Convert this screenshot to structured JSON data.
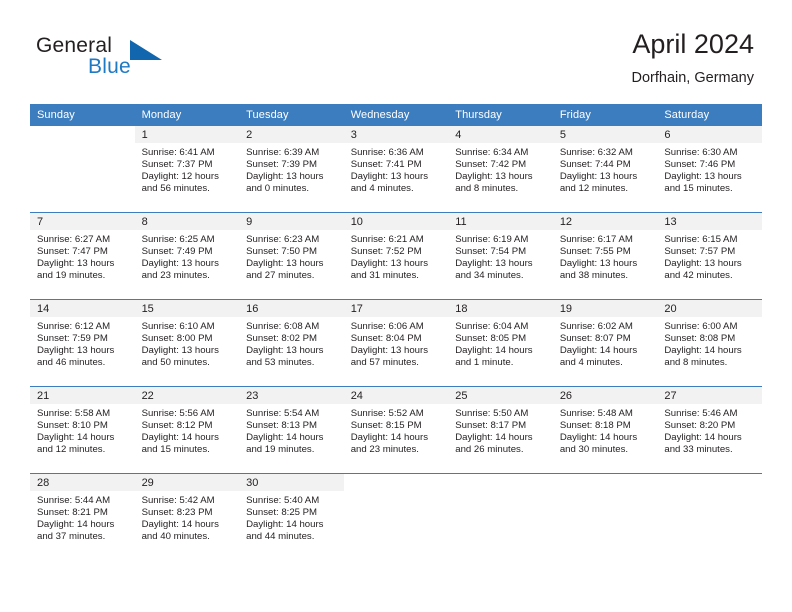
{
  "brand": {
    "word1": "General",
    "word2": "Blue",
    "triangle_color": "#1166ad",
    "blue_text_color": "#1f7ac4"
  },
  "header": {
    "title": "April 2024",
    "subtitle": "Dorfhain, Germany",
    "header_bg": "#3c7dbf",
    "daynum_band_bg": "#f2f2f2"
  },
  "weekdays": [
    "Sunday",
    "Monday",
    "Tuesday",
    "Wednesday",
    "Thursday",
    "Friday",
    "Saturday"
  ],
  "labels": {
    "sunrise_prefix": "Sunrise:",
    "sunset_prefix": "Sunset:",
    "daylight_prefix": "Daylight:"
  },
  "weeks": [
    [
      {
        "day": "",
        "blank": true
      },
      {
        "day": "1",
        "sunrise": "Sunrise: 6:41 AM",
        "sunset": "Sunset: 7:37 PM",
        "daylight1": "Daylight: 12 hours",
        "daylight2": "and 56 minutes."
      },
      {
        "day": "2",
        "sunrise": "Sunrise: 6:39 AM",
        "sunset": "Sunset: 7:39 PM",
        "daylight1": "Daylight: 13 hours",
        "daylight2": "and 0 minutes."
      },
      {
        "day": "3",
        "sunrise": "Sunrise: 6:36 AM",
        "sunset": "Sunset: 7:41 PM",
        "daylight1": "Daylight: 13 hours",
        "daylight2": "and 4 minutes."
      },
      {
        "day": "4",
        "sunrise": "Sunrise: 6:34 AM",
        "sunset": "Sunset: 7:42 PM",
        "daylight1": "Daylight: 13 hours",
        "daylight2": "and 8 minutes."
      },
      {
        "day": "5",
        "sunrise": "Sunrise: 6:32 AM",
        "sunset": "Sunset: 7:44 PM",
        "daylight1": "Daylight: 13 hours",
        "daylight2": "and 12 minutes."
      },
      {
        "day": "6",
        "sunrise": "Sunrise: 6:30 AM",
        "sunset": "Sunset: 7:46 PM",
        "daylight1": "Daylight: 13 hours",
        "daylight2": "and 15 minutes."
      }
    ],
    [
      {
        "day": "7",
        "sunrise": "Sunrise: 6:27 AM",
        "sunset": "Sunset: 7:47 PM",
        "daylight1": "Daylight: 13 hours",
        "daylight2": "and 19 minutes."
      },
      {
        "day": "8",
        "sunrise": "Sunrise: 6:25 AM",
        "sunset": "Sunset: 7:49 PM",
        "daylight1": "Daylight: 13 hours",
        "daylight2": "and 23 minutes."
      },
      {
        "day": "9",
        "sunrise": "Sunrise: 6:23 AM",
        "sunset": "Sunset: 7:50 PM",
        "daylight1": "Daylight: 13 hours",
        "daylight2": "and 27 minutes."
      },
      {
        "day": "10",
        "sunrise": "Sunrise: 6:21 AM",
        "sunset": "Sunset: 7:52 PM",
        "daylight1": "Daylight: 13 hours",
        "daylight2": "and 31 minutes."
      },
      {
        "day": "11",
        "sunrise": "Sunrise: 6:19 AM",
        "sunset": "Sunset: 7:54 PM",
        "daylight1": "Daylight: 13 hours",
        "daylight2": "and 34 minutes."
      },
      {
        "day": "12",
        "sunrise": "Sunrise: 6:17 AM",
        "sunset": "Sunset: 7:55 PM",
        "daylight1": "Daylight: 13 hours",
        "daylight2": "and 38 minutes."
      },
      {
        "day": "13",
        "sunrise": "Sunrise: 6:15 AM",
        "sunset": "Sunset: 7:57 PM",
        "daylight1": "Daylight: 13 hours",
        "daylight2": "and 42 minutes."
      }
    ],
    [
      {
        "day": "14",
        "sunrise": "Sunrise: 6:12 AM",
        "sunset": "Sunset: 7:59 PM",
        "daylight1": "Daylight: 13 hours",
        "daylight2": "and 46 minutes."
      },
      {
        "day": "15",
        "sunrise": "Sunrise: 6:10 AM",
        "sunset": "Sunset: 8:00 PM",
        "daylight1": "Daylight: 13 hours",
        "daylight2": "and 50 minutes."
      },
      {
        "day": "16",
        "sunrise": "Sunrise: 6:08 AM",
        "sunset": "Sunset: 8:02 PM",
        "daylight1": "Daylight: 13 hours",
        "daylight2": "and 53 minutes."
      },
      {
        "day": "17",
        "sunrise": "Sunrise: 6:06 AM",
        "sunset": "Sunset: 8:04 PM",
        "daylight1": "Daylight: 13 hours",
        "daylight2": "and 57 minutes."
      },
      {
        "day": "18",
        "sunrise": "Sunrise: 6:04 AM",
        "sunset": "Sunset: 8:05 PM",
        "daylight1": "Daylight: 14 hours",
        "daylight2": "and 1 minute."
      },
      {
        "day": "19",
        "sunrise": "Sunrise: 6:02 AM",
        "sunset": "Sunset: 8:07 PM",
        "daylight1": "Daylight: 14 hours",
        "daylight2": "and 4 minutes."
      },
      {
        "day": "20",
        "sunrise": "Sunrise: 6:00 AM",
        "sunset": "Sunset: 8:08 PM",
        "daylight1": "Daylight: 14 hours",
        "daylight2": "and 8 minutes."
      }
    ],
    [
      {
        "day": "21",
        "sunrise": "Sunrise: 5:58 AM",
        "sunset": "Sunset: 8:10 PM",
        "daylight1": "Daylight: 14 hours",
        "daylight2": "and 12 minutes."
      },
      {
        "day": "22",
        "sunrise": "Sunrise: 5:56 AM",
        "sunset": "Sunset: 8:12 PM",
        "daylight1": "Daylight: 14 hours",
        "daylight2": "and 15 minutes."
      },
      {
        "day": "23",
        "sunrise": "Sunrise: 5:54 AM",
        "sunset": "Sunset: 8:13 PM",
        "daylight1": "Daylight: 14 hours",
        "daylight2": "and 19 minutes."
      },
      {
        "day": "24",
        "sunrise": "Sunrise: 5:52 AM",
        "sunset": "Sunset: 8:15 PM",
        "daylight1": "Daylight: 14 hours",
        "daylight2": "and 23 minutes."
      },
      {
        "day": "25",
        "sunrise": "Sunrise: 5:50 AM",
        "sunset": "Sunset: 8:17 PM",
        "daylight1": "Daylight: 14 hours",
        "daylight2": "and 26 minutes."
      },
      {
        "day": "26",
        "sunrise": "Sunrise: 5:48 AM",
        "sunset": "Sunset: 8:18 PM",
        "daylight1": "Daylight: 14 hours",
        "daylight2": "and 30 minutes."
      },
      {
        "day": "27",
        "sunrise": "Sunrise: 5:46 AM",
        "sunset": "Sunset: 8:20 PM",
        "daylight1": "Daylight: 14 hours",
        "daylight2": "and 33 minutes."
      }
    ],
    [
      {
        "day": "28",
        "sunrise": "Sunrise: 5:44 AM",
        "sunset": "Sunset: 8:21 PM",
        "daylight1": "Daylight: 14 hours",
        "daylight2": "and 37 minutes."
      },
      {
        "day": "29",
        "sunrise": "Sunrise: 5:42 AM",
        "sunset": "Sunset: 8:23 PM",
        "daylight1": "Daylight: 14 hours",
        "daylight2": "and 40 minutes."
      },
      {
        "day": "30",
        "sunrise": "Sunrise: 5:40 AM",
        "sunset": "Sunset: 8:25 PM",
        "daylight1": "Daylight: 14 hours",
        "daylight2": "and 44 minutes."
      },
      {
        "day": "",
        "blank": true
      },
      {
        "day": "",
        "blank": true
      },
      {
        "day": "",
        "blank": true
      },
      {
        "day": "",
        "blank": true
      }
    ]
  ]
}
